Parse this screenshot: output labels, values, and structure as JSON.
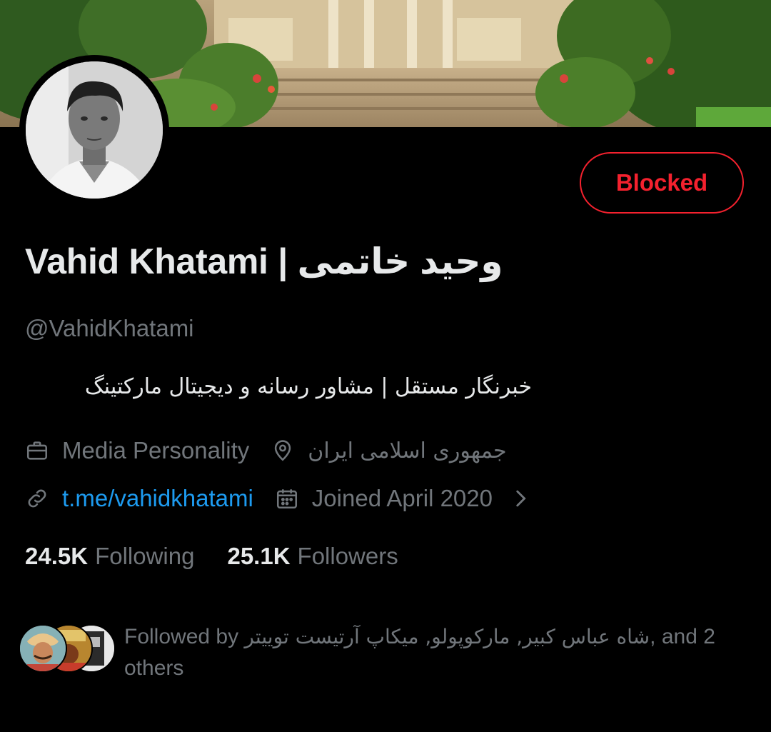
{
  "profile": {
    "display_name": "Vahid Khatami | وحید خاتمی",
    "handle": "@VahidKhatami",
    "bio": "خبرنگار مستقل | مشاور رسانه و دیجیتال مارکتینگ",
    "category": "Media Personality",
    "location": "جمهوری اسلامی ایران",
    "website": "t.me/vahidkhatami",
    "joined": "Joined April 2020"
  },
  "actions": {
    "blocked_label": "Blocked"
  },
  "stats": {
    "following_count": "24.5K",
    "following_label": "Following",
    "followers_count": "25.1K",
    "followers_label": "Followers"
  },
  "followed_by": {
    "prefix": "Followed by",
    "names": "شاه عباس کبیر, مارکوپولو, میکاپ آرتیست توییتر",
    "suffix": ", and 2 others"
  },
  "icons": {
    "category": "briefcase-icon",
    "location": "location-pin-icon",
    "link": "link-icon",
    "joined": "calendar-icon",
    "expand": "chevron-right-icon"
  },
  "colors": {
    "background": "#000000",
    "text_primary": "#e7e9ea",
    "text_secondary": "#71767b",
    "link": "#1d9bf0",
    "blocked": "#f4212e"
  }
}
